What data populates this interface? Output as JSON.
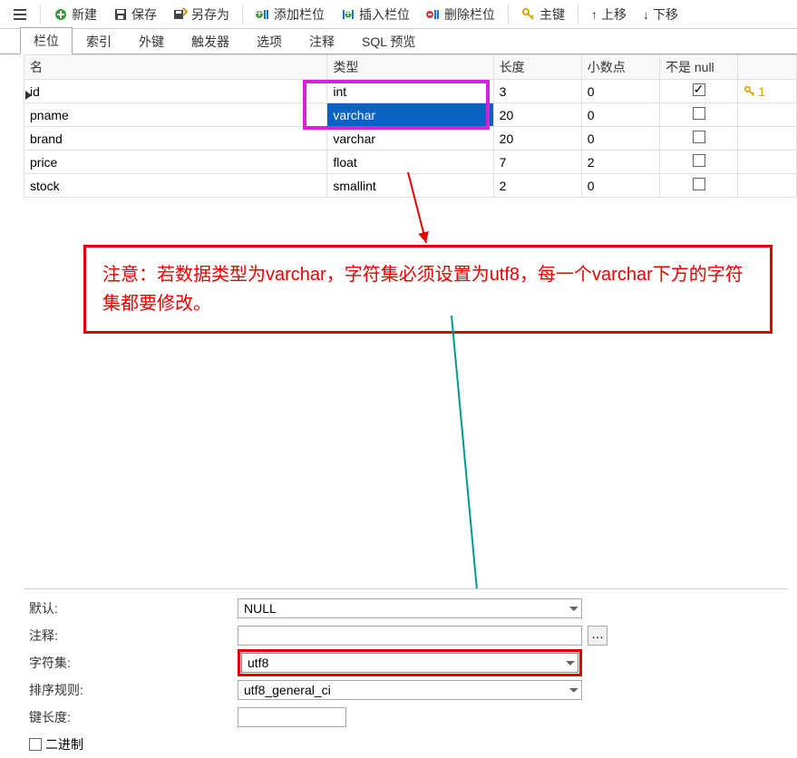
{
  "toolbar": {
    "new": "新建",
    "save": "保存",
    "saveas": "另存为",
    "addcol": "添加栏位",
    "inscol": "插入栏位",
    "delcol": "删除栏位",
    "pkey": "主键",
    "moveup": "上移",
    "movedown": "下移"
  },
  "tabs": [
    "栏位",
    "索引",
    "外键",
    "触发器",
    "选项",
    "注释",
    "SQL 预览"
  ],
  "active_tab": 0,
  "grid": {
    "headers": {
      "name": "名",
      "type": "类型",
      "len": "长度",
      "dec": "小数点",
      "notnull": "不是 null",
      "key": ""
    },
    "rows": [
      {
        "name": "id",
        "type": "int",
        "len": "3",
        "dec": "0",
        "notnull": true,
        "key": "1"
      },
      {
        "name": "pname",
        "type": "varchar",
        "len": "20",
        "dec": "0",
        "notnull": false,
        "current": true
      },
      {
        "name": "brand",
        "type": "varchar",
        "len": "20",
        "dec": "0",
        "notnull": false
      },
      {
        "name": "price",
        "type": "float",
        "len": "7",
        "dec": "2",
        "notnull": false
      },
      {
        "name": "stock",
        "type": "smallint",
        "len": "2",
        "dec": "0",
        "notnull": false
      }
    ]
  },
  "note": "注意：若数据类型为varchar，字符集必须设置为utf8，每一个varchar下方的字符集都要修改。",
  "props": {
    "default_label": "默认:",
    "default_value": "NULL",
    "comment_label": "注释:",
    "comment_value": "",
    "charset_label": "字符集:",
    "charset_value": "utf8",
    "collation_label": "排序规则:",
    "collation_value": "utf8_general_ci",
    "keylen_label": "键长度:",
    "keylen_value": "",
    "binary_label": "二进制"
  }
}
